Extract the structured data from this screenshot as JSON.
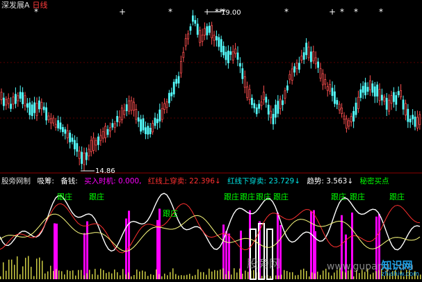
{
  "title_bar": {
    "stock_name": "深发展A",
    "period": "日线"
  },
  "price_annotations": {
    "high_label": "19.00",
    "low_label": "14.86"
  },
  "signal_markers": [
    "*",
    "+",
    "*",
    "+",
    "*",
    "*",
    "*",
    "*",
    "+",
    "*",
    "*",
    "*"
  ],
  "indicator": {
    "name": "股旁网制",
    "items": [
      {
        "label": "吸筹:",
        "value": "",
        "color": "#ffffff"
      },
      {
        "label": "备钱:",
        "value": "",
        "color": "#ffffff"
      },
      {
        "label": "买入时机:",
        "value": "0.000,",
        "color": "#ff00ff"
      },
      {
        "label": "红线上穿卖:",
        "value": "22.396",
        "arrow": "↓",
        "color": "#ff3030"
      },
      {
        "label": "红线下穿卖:",
        "value": "23.729",
        "arrow": "↓",
        "color": "#00e0e0"
      },
      {
        "label": "趋势:",
        "value": "3.563",
        "arrow": "↓",
        "color": "#ffffff"
      },
      {
        "label": "秘密买点",
        "value": "",
        "color": "#00ff00"
      }
    ],
    "signal_label": "跟庄"
  },
  "colors": {
    "up_candle": "#ff5050",
    "down_candle": "#54fcfc",
    "grid": "#8b0000",
    "bars_magenta": "#ff00ff",
    "bars_yellow": "#ffff55",
    "line_white": "#ffffff",
    "line_red": "#ff3030",
    "line_yellow": "#ffff80"
  },
  "watermark": {
    "left_text": "股旁网",
    "url": "www.gupang.com"
  },
  "site_badge": {
    "name": "知识网",
    "domain": "zhishiw.com"
  }
}
